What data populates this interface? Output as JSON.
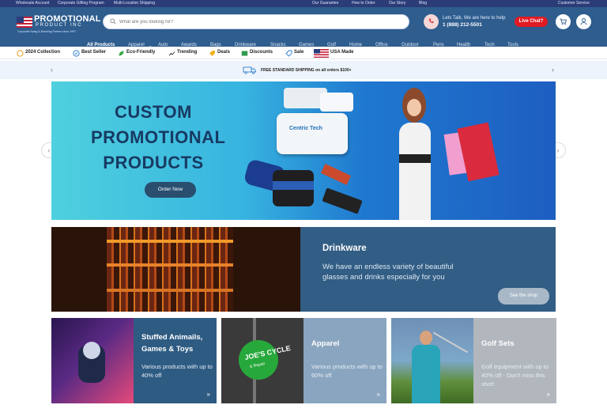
{
  "topbar": {
    "left": [
      "Wholesale Account",
      "Corporate Gifting Program",
      "Multi-Location Shipping"
    ],
    "center": [
      "Our Guarantee",
      "How to Order",
      "Our Story",
      "Blog"
    ],
    "right": "Customer Service"
  },
  "logo": {
    "line1": "PROMOTIONAL",
    "line2": "PRODUCT INC",
    "tagline": "Corporate Swag & Branding Partner since 1997"
  },
  "search": {
    "placeholder": "What are you looking for?"
  },
  "contact": {
    "line1": "Lets Talk, We are here to help",
    "phone": "1 (888) 212-5501",
    "chat": "Live Chat?"
  },
  "nav": [
    "All Products",
    "Apparel",
    "Auto",
    "Awards",
    "Bags",
    "Drinkware",
    "Snacks",
    "Games",
    "Golf",
    "Home",
    "Office",
    "Outdoor",
    "Pens",
    "Health",
    "Tech",
    "Tools"
  ],
  "categories": [
    "2024 Collection",
    "Best Seller",
    "Eco-Friendly",
    "Trending",
    "Deals",
    "Discounts",
    "Sale",
    "USA Made"
  ],
  "shipping": "FREE STANDARD SHIPPING on all orders $100+",
  "hero": {
    "line1": "CUSTOM",
    "line2": "PROMOTIONAL",
    "line3": "PRODUCTS",
    "button": "Order Now",
    "product_brand": "Centric Tech"
  },
  "drinkware": {
    "title": "Drinkware",
    "body": "We have an endless variety of beautiful glasses and drinks especially for you",
    "button": "See the shop"
  },
  "cards": [
    {
      "title": "Stuffed Animails, Games & Toys",
      "body": "Various products with up to 40% off",
      "bg": "#2e5b82"
    },
    {
      "title": "Apparel",
      "body": "Various products with up to 60% off",
      "bg": "#8aa5bf",
      "img_text": "JOE'S CYCLE",
      "img_sub": "& Repair"
    },
    {
      "title": "Golf Sets",
      "body": "Golf equipment with up to 40% off - Don't miss this shot!",
      "bg": "#b2b7bd"
    }
  ],
  "colors": {
    "topbar": "#2b3c77",
    "header": "#2e5d8e",
    "chat": "#e21b23"
  }
}
